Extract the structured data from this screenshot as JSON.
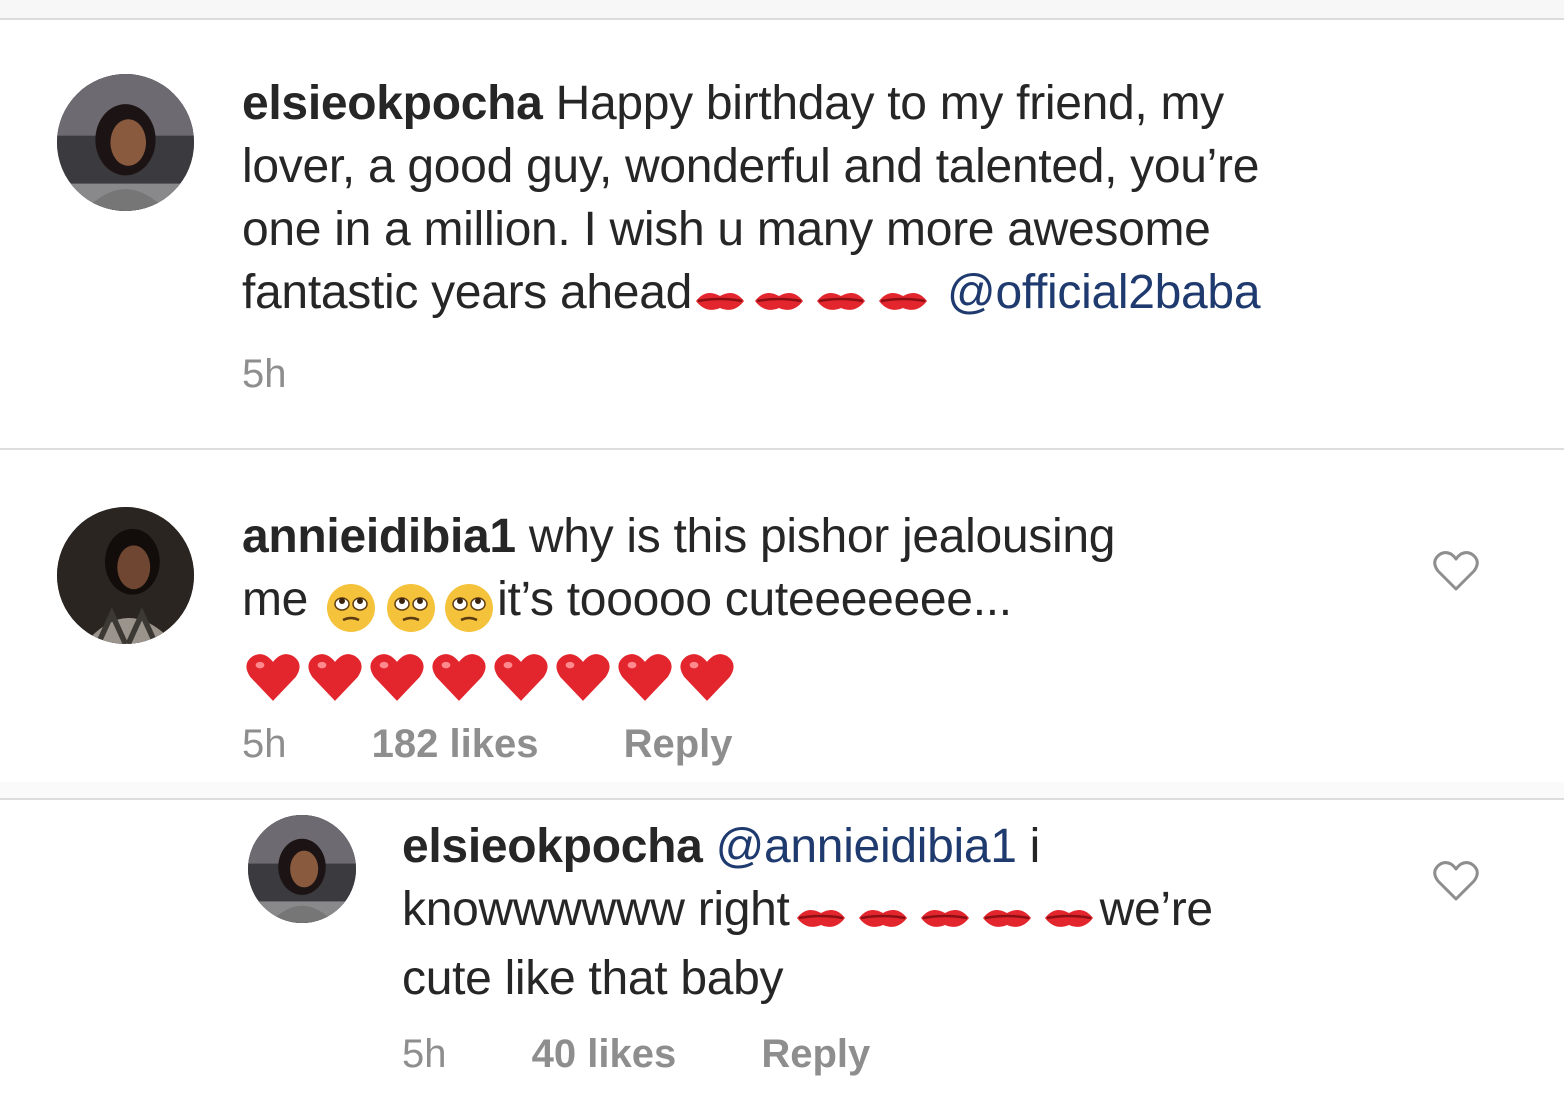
{
  "comments": [
    {
      "username": "elsieokpocha",
      "text_line1": "Happy birthday to my friend, my",
      "text_line2": "lover, a good guy, wonderful and talented, you’re",
      "text_line3": "one in a million. I wish u many more awesome",
      "text_line4": "fantastic years ahead",
      "mention": "@official2baba",
      "emoji_count": 4,
      "emoji": "kiss-mark",
      "time": "5h"
    },
    {
      "username": "annieidibia1",
      "text_line1": "why is this pishor jealousing",
      "text_line2a": "me ",
      "text_line2b": "it’s tooooo cuteeeeeee...",
      "emoji_rolling_eyes": 3,
      "emoji_hearts": 8,
      "time": "5h",
      "likes": "182 likes",
      "reply": "Reply"
    },
    {
      "username": "elsieokpocha",
      "mention": "@annieidibia1",
      "text_line1_tail": " i",
      "text_line2a": "knowwwwww right",
      "text_line2b": "we’re",
      "text_line3": "cute like that baby",
      "emoji_count": 5,
      "time": "5h",
      "likes": "40 likes",
      "reply": "Reply"
    }
  ],
  "colors": {
    "text": "#262626",
    "meta": "#8e8e8e",
    "mention": "#1e3a6e",
    "heart_emoji": "#e3262d"
  },
  "icons": [
    "heart-outline-icon",
    "kiss-mark-icon",
    "red-heart-icon",
    "rolling-eyes-icon"
  ]
}
